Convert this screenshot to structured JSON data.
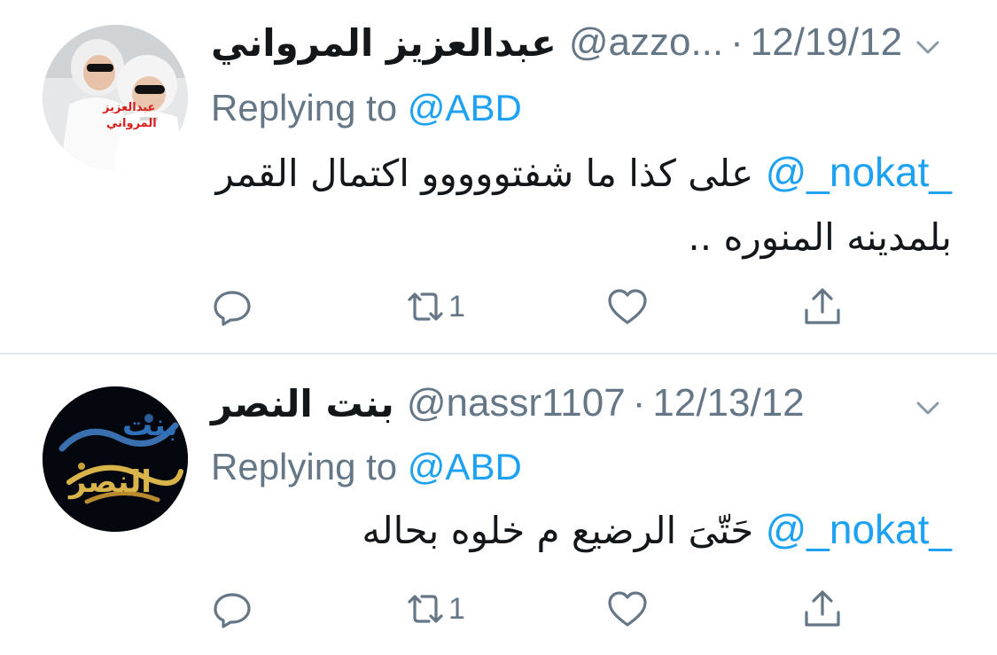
{
  "tweets": [
    {
      "name": "عبدالعزيز المرواني",
      "handle": "@azzo...",
      "separator": "·",
      "date": "12/19/12",
      "replying_label": "Replying to",
      "replying_to": "@ABD",
      "mention": "@_nokat_",
      "text": "على كذا ما شفتووووو اكتمال القمر بلمدينه المنوره ..",
      "avatar_text": [
        "عبدالعزيز",
        "المرواني"
      ],
      "retweet_count": "1",
      "icons": [
        "reply-icon",
        "retweet-icon",
        "like-icon",
        "share-icon",
        "caret-down-icon"
      ]
    },
    {
      "name": "بنت النصر",
      "handle": "@nassr1107",
      "separator": "·",
      "date": "12/13/12",
      "replying_label": "Replying to",
      "replying_to": "@ABD",
      "mention": "@_nokat_",
      "text": "حَتّىَ الرضيع م خلوه بحاله",
      "avatar_text": [
        "بنت",
        "النصر"
      ],
      "retweet_count": "1",
      "icons": [
        "reply-icon",
        "retweet-icon",
        "like-icon",
        "share-icon",
        "caret-down-icon"
      ]
    }
  ],
  "colors": {
    "accent": "#1da1f2",
    "secondary_text": "#657786",
    "primary_text": "#14171a",
    "divider": "#e1e8ed"
  }
}
